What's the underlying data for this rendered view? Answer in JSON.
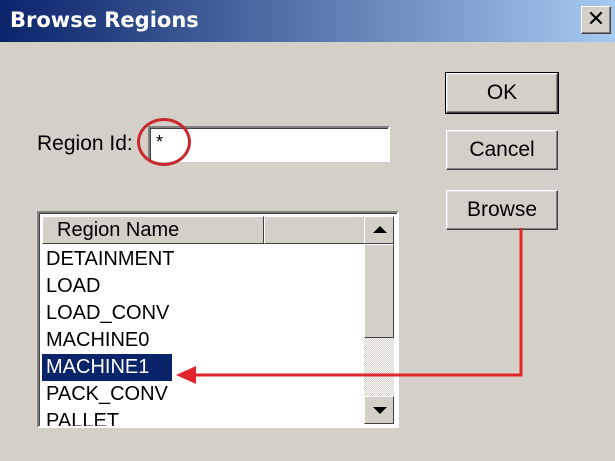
{
  "window": {
    "title": "Browse Regions",
    "close_glyph": "✕"
  },
  "form": {
    "region_id_label": "Region Id:",
    "region_id_value": "*"
  },
  "buttons": {
    "ok": "OK",
    "cancel": "Cancel",
    "browse": "Browse"
  },
  "list": {
    "header": [
      "Region Name",
      ""
    ],
    "items": [
      "DETAINMENT",
      "LOAD",
      "LOAD_CONV",
      "MACHINE0",
      "MACHINE1",
      "PACK_CONV",
      "PALLET"
    ],
    "selected": "MACHINE1"
  },
  "colors": {
    "title_start": "#0a246a",
    "title_end": "#a6caf0",
    "annotation_red": "#e0262d",
    "selection": "#0a246a"
  }
}
